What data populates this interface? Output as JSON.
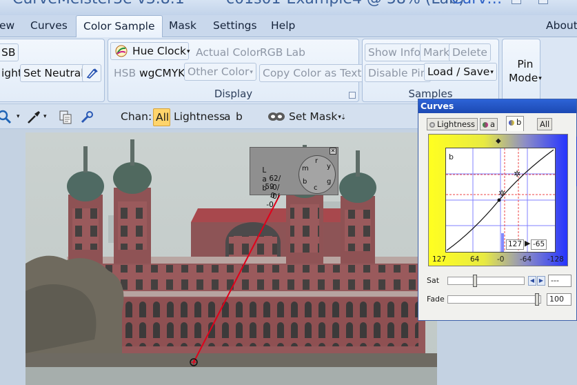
{
  "title": {
    "app": "• CurveMeister3e v3.8.1",
    "document": "c01s01-Example4 @ 58% (Lab)",
    "window_suffix": "- Curv…"
  },
  "menu": {
    "items": [
      "ew",
      "Curves",
      "Color Sample",
      "Mask",
      "Settings",
      "Help"
    ],
    "about": "About",
    "active": "Color Sample"
  },
  "ribbon": {
    "left_group": {
      "row1": "SB",
      "row2_prefix": "ight",
      "set_neutral": "Set Neutral"
    },
    "display": {
      "hue_clock": "Hue Clock",
      "actual_color": "Actual Color",
      "rgb": "RGB",
      "lab": "Lab",
      "hsb": "HSB",
      "wgcmyk": "wgCMYK",
      "other_color": "Other Color",
      "copy_color_as_text": "Copy Color as Text",
      "label": "Display"
    },
    "samples": {
      "show_info": "Show Info",
      "mark": "Mark",
      "delete": "Delete",
      "disable_pin": "Disable Pin",
      "load_save": "Load / Save",
      "label": "Samples"
    },
    "pin_mode": {
      "line1": "Pin",
      "line2": "Mode"
    }
  },
  "toolbar": {
    "chan_label": "Chan:",
    "channels": [
      "All",
      "Lightness",
      "a",
      "b"
    ],
    "active_channel": "All",
    "set_mask": "Set Mask"
  },
  "readout": {
    "rows": [
      {
        "label": "L",
        "v1": "62/",
        "v2": "59"
      },
      {
        "label": "a",
        "v1": "-0/",
        "v2": "0"
      },
      {
        "label": "b",
        "v1": "-0/",
        "v2": "-0"
      }
    ],
    "clock_letters": [
      "r",
      "y",
      "m",
      "b",
      "g",
      "c"
    ]
  },
  "curves": {
    "title": "Curves",
    "tabs": [
      "Lightness",
      "a",
      "b",
      "All"
    ],
    "active_tab": "b",
    "plot_label": "b",
    "axis_ticks": [
      "127",
      "64",
      "-0",
      "-64",
      "-128"
    ],
    "input_value": "127",
    "output_value": "-65",
    "sat_label": "Sat",
    "sat_value": "---",
    "fade_label": "Fade",
    "fade_value": "100",
    "sat_level": 0.35,
    "fade_level": 1.0
  },
  "colors": {
    "accent_blue": "#1c49b3",
    "sample_line": "#e0001a",
    "chan_highlight": "#ffd46b"
  }
}
